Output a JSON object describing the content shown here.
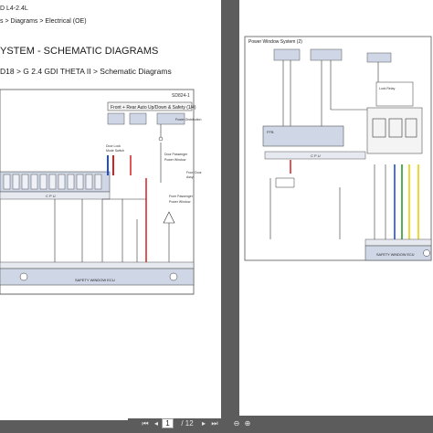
{
  "left_page": {
    "breadcrumb_model": "D L4-2.4L",
    "breadcrumb_nav": "s > Diagrams > Electrical (OE)",
    "title": "YSTEM - SCHEMATIC DIAGRAMS",
    "path": "D18 > G 2.4 GDI THETA II > Schematic Diagrams",
    "diagram_code": "SD824-1",
    "diagram_header": "Front + Rear Auto Up/Down & Safety (1/4)",
    "module_label": "SAFETY WINDOW ECU"
  },
  "right_page": {
    "diagram_header": "Power Window System (2)",
    "module_label": "SAFETY WINDOW ECU"
  },
  "toolbar": {
    "current_page": "1",
    "total_pages": "/ 12",
    "first_icon": "first-page-icon",
    "prev_icon": "prev-page-icon",
    "next_icon": "next-page-icon",
    "last_icon": "last-page-icon",
    "zoom_out_icon": "zoom-out-icon",
    "zoom_in_icon": "zoom-in-icon"
  },
  "colors": {
    "viewer_bg": "#5c5c5c",
    "page_bg": "#ffffff",
    "wire_red": "#d42020",
    "wire_blue": "#1f4fd0",
    "wire_yellow": "#e8d000",
    "wire_green": "#2a9a2a",
    "box_fill": "#cfd6e6"
  }
}
